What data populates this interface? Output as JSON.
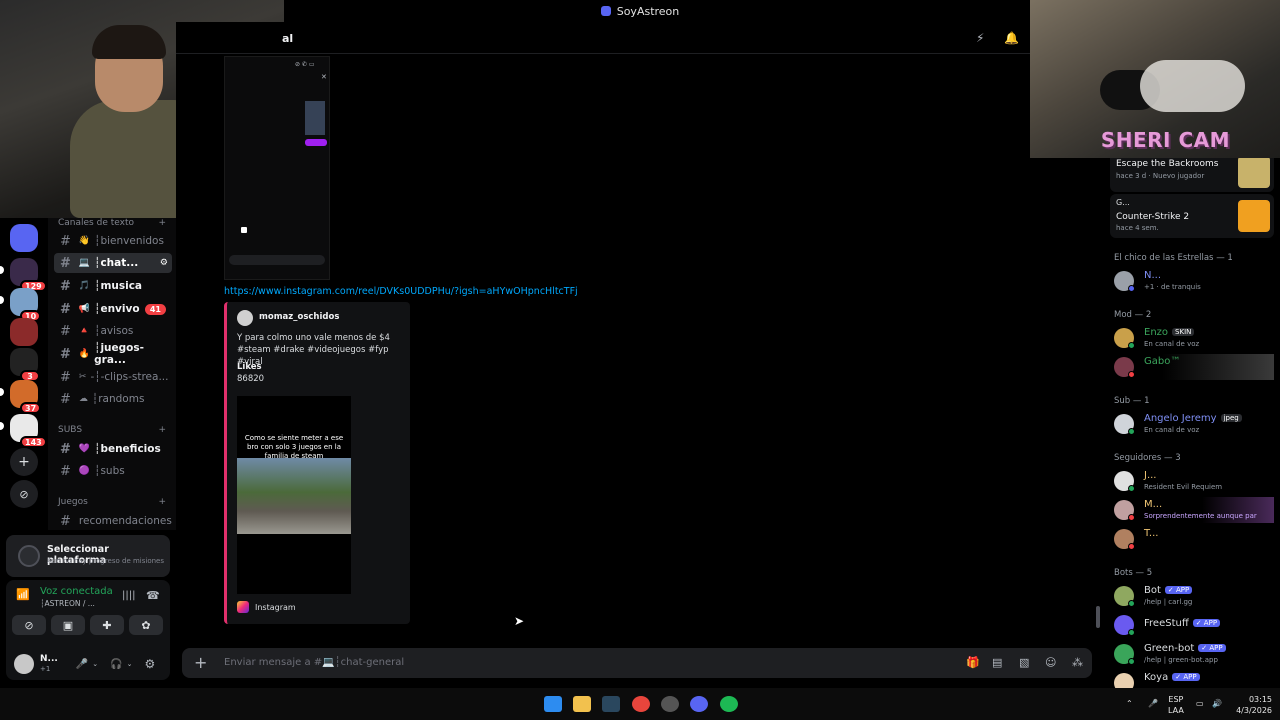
{
  "window": {
    "title": "SoyAstreon"
  },
  "overlay": {
    "cam_label": "SHERI CAM"
  },
  "servers": {
    "badges": [
      "129",
      "10",
      "37",
      "143",
      "3"
    ]
  },
  "channels": {
    "category_text": "Canales de texto",
    "items": [
      {
        "emoji": "👋",
        "label": "┆bienvenidos",
        "bold": false
      },
      {
        "emoji": "💻",
        "label": "┆chat...",
        "bold": true
      },
      {
        "emoji": "🎵",
        "label": "┆musica",
        "bold": true
      },
      {
        "emoji": "📢",
        "label": "┆envivo",
        "bold": true,
        "count": "41"
      },
      {
        "emoji": "🔺",
        "label": "┆avisos",
        "bold": false
      },
      {
        "emoji": "🔥",
        "label": "┆juegos-gra...",
        "bold": true
      },
      {
        "emoji": "✂",
        "label": "-┆-clips-strea...",
        "bold": false
      },
      {
        "emoji": "☁",
        "label": "┆randoms",
        "bold": false
      }
    ],
    "category_subs": "SUBS",
    "subs_items": [
      {
        "emoji": "💜",
        "label": "┆beneficios",
        "bold": true
      },
      {
        "emoji": "🟣",
        "label": "┆subs",
        "bold": false
      }
    ],
    "category_games": "Juegos",
    "games_items": [
      {
        "label": "recomendaciones"
      }
    ]
  },
  "quest": {
    "title": "Seleccionar plataforma",
    "subtitle": "Aún no hay progreso de misiones"
  },
  "voice": {
    "status": "Voz conectada",
    "channel": "┆ASTREON / ..."
  },
  "user": {
    "name": "N...",
    "status": "+1"
  },
  "chat": {
    "channel_title": "al",
    "link": "https://www.instagram.com/reel/DVKs0UDDPHu/?igsh=aHYwOHpncHltcTFj",
    "embed": {
      "author": "momaz_oschidos",
      "description": "Y para colmo uno vale menos de $4 #steam #drake #videojuegos #fyp #viral",
      "likes_label": "Likes",
      "likes_value": "86820",
      "media_caption": "Como se siente meter a ese bro con solo 3 juegos en la familia de steam",
      "footer": "Instagram"
    },
    "composer_placeholder": "Enviar mensaje a #💻┆chat-general"
  },
  "members": {
    "activity_cards": [
      {
        "game": "Escape the Backrooms",
        "meta": "hace 3 d · Nuevo jugador"
      },
      {
        "user": "G...",
        "game": "Counter-Strike 2",
        "meta": "hace 4 sem."
      }
    ],
    "sections": [
      {
        "title": "El chico de las Estrellas — 1",
        "members": [
          {
            "name": "N...",
            "status": "+1 · de tranquis",
            "color": "#7f8ff4"
          }
        ]
      },
      {
        "title": "Mod — 2",
        "members": [
          {
            "name": "Enzo",
            "tag": "SKIN",
            "status": "En canal de voz",
            "color": "#3ba55c"
          },
          {
            "name": "Gabo™",
            "status": "",
            "color": "#3ba55c"
          }
        ]
      },
      {
        "title": "Sub — 1",
        "members": [
          {
            "name": "Angelo Jeremy",
            "tag": "jpeg",
            "status": "En canal de voz",
            "color": "#7f8ff4"
          }
        ]
      },
      {
        "title": "Seguidores — 3",
        "members": [
          {
            "name": "J...",
            "status": "Resident Evil Requiem",
            "color": "#f0c674"
          },
          {
            "name": "M...",
            "status": "Sorprendentemente aunque par",
            "color": "#f0c674"
          },
          {
            "name": "T...",
            "status": "",
            "color": "#f0c674"
          }
        ]
      },
      {
        "title": "Bots — 5",
        "members": [
          {
            "name": "Bot",
            "tag": "✓ APP",
            "status": "/help | carl.gg",
            "color": "#dbdee1"
          },
          {
            "name": "FreeStuff",
            "tag": "✓ APP",
            "status": "",
            "color": "#dbdee1"
          },
          {
            "name": "Green-bot",
            "tag": "✓ APP",
            "status": "/help | green-bot.app",
            "color": "#dbdee1"
          },
          {
            "name": "Koya",
            "tag": "✓ APP",
            "status": "",
            "color": "#dbdee1"
          }
        ]
      }
    ]
  },
  "taskbar": {
    "lang": "ESP",
    "layout": "LAA",
    "time": "03:15",
    "date": "4/3/2026"
  }
}
